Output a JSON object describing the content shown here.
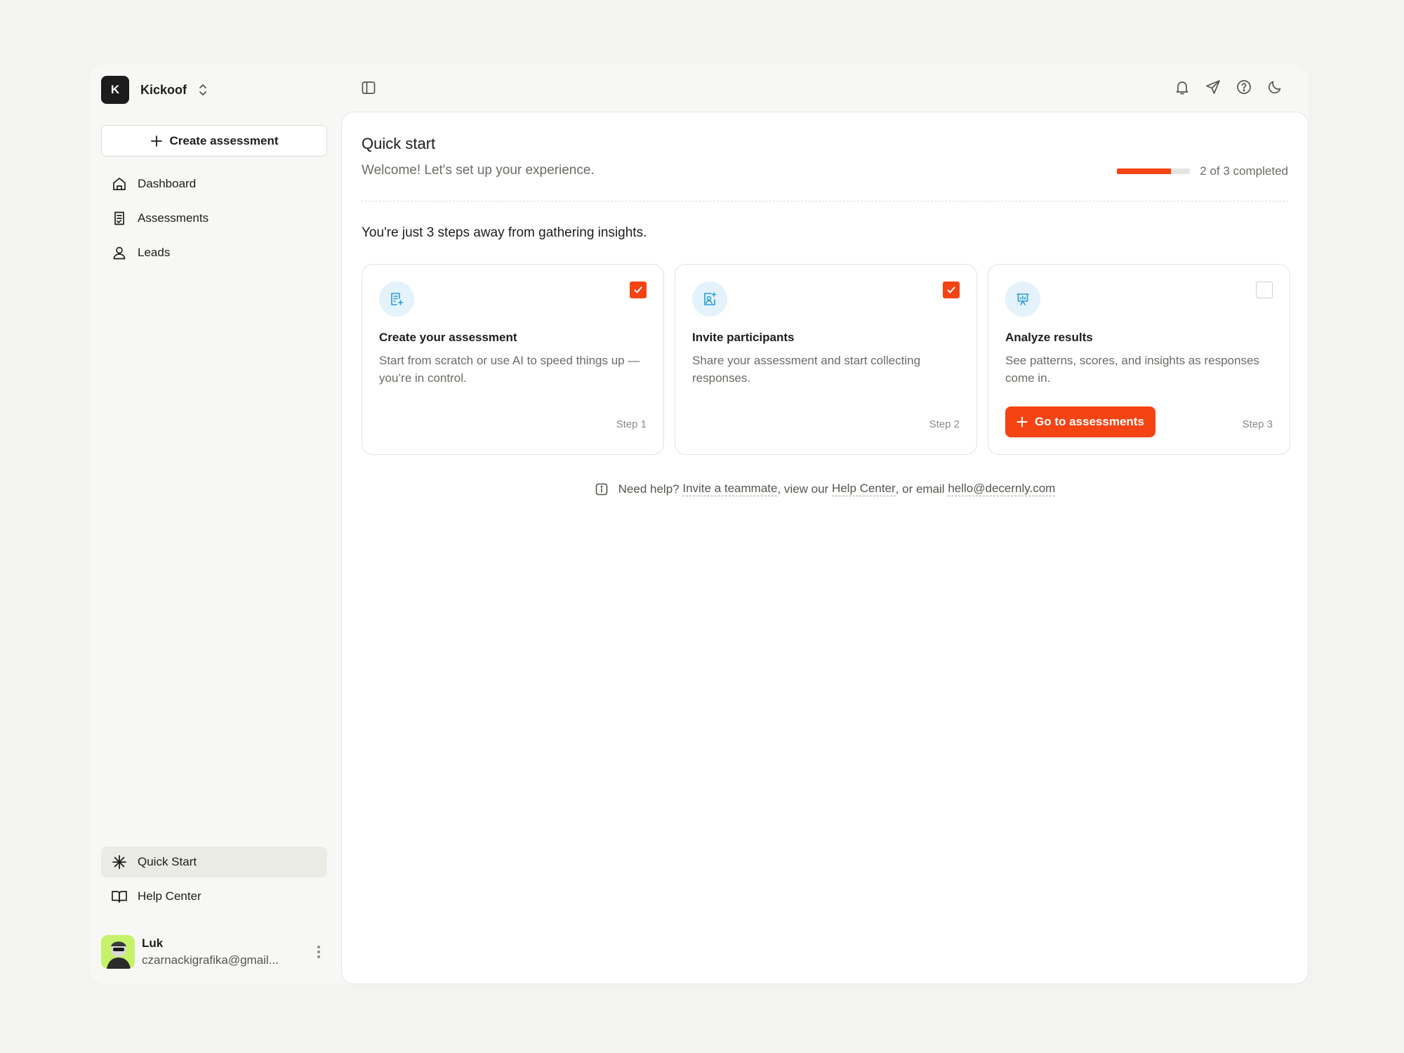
{
  "brand": {
    "initial": "K",
    "name": "Kickoof"
  },
  "sidebar": {
    "create_label": "Create assessment",
    "items": [
      {
        "label": "Dashboard",
        "icon": "home-icon"
      },
      {
        "label": "Assessments",
        "icon": "assessment-icon"
      },
      {
        "label": "Leads",
        "icon": "user-icon"
      }
    ],
    "bottom_items": [
      {
        "label": "Quick Start",
        "icon": "asterisk-icon",
        "active": true
      },
      {
        "label": "Help Center",
        "icon": "book-icon"
      }
    ]
  },
  "user": {
    "name": "Luk",
    "email": "czarnackigrafika@gmail..."
  },
  "topbar": {
    "icons": [
      "bell-icon",
      "send-icon",
      "help-icon",
      "moon-icon"
    ]
  },
  "quickstart": {
    "title": "Quick start",
    "subtitle": "Welcome! Let's set up your experience.",
    "progress_text": "2 of 3 completed",
    "progress_fraction": 0.74,
    "headline": "You're just 3 steps away from gathering insights.",
    "cards": [
      {
        "title": "Create your assessment",
        "desc": "Start from scratch or use AI to speed things up — you’re in control.",
        "step": "Step 1",
        "done": true
      },
      {
        "title": "Invite participants",
        "desc": "Share your assessment and start collecting responses.",
        "step": "Step 2",
        "done": true
      },
      {
        "title": "Analyze results",
        "desc": "See patterns, scores, and insights as responses come in.",
        "step": "Step 3",
        "done": false,
        "button": "Go to assessments"
      }
    ],
    "help": {
      "prefix": "Need help?",
      "link1": "Invite a teammate",
      "mid1": ", view our",
      "link2": "Help Center",
      "mid2": ", or email",
      "link3": "hello@decernly.com"
    }
  },
  "colors": {
    "accent": "#f44414",
    "icon_bg": "#e3f2fb",
    "icon_fg": "#2a9bd6"
  }
}
